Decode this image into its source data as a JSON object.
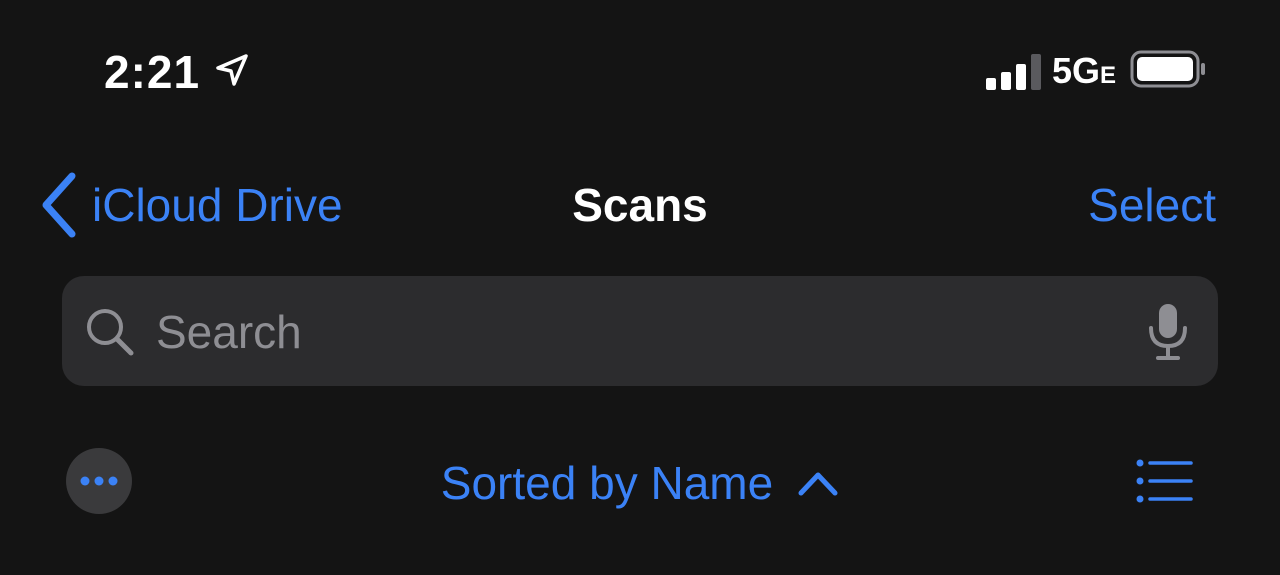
{
  "status_bar": {
    "time": "2:21",
    "network_main": "5G",
    "network_suffix": "E",
    "icons": [
      "location-arrow-icon",
      "cellular-signal-icon",
      "battery-icon"
    ]
  },
  "nav": {
    "back_label": "iCloud Drive",
    "title": "Scans",
    "select_label": "Select"
  },
  "search": {
    "placeholder": "Search",
    "value": "",
    "icons": [
      "search-icon",
      "microphone-icon"
    ]
  },
  "toolbar": {
    "sort_label": "Sorted by Name",
    "sort_direction_icon": "chevron-up-icon",
    "more_icon": "ellipsis-icon",
    "view_icon": "list-view-icon"
  },
  "colors": {
    "background": "#141414",
    "accent": "#3b82f6",
    "search_field": "#2c2c2e",
    "placeholder": "#8e8e93"
  }
}
